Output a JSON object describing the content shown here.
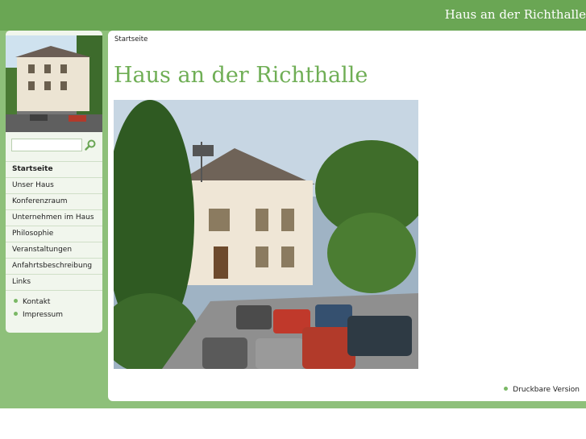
{
  "header": {
    "site_title": "Haus an der Richthalle"
  },
  "sidebar": {
    "search": {
      "value": "",
      "placeholder": ""
    },
    "nav": [
      {
        "label": "Startseite",
        "active": true
      },
      {
        "label": "Unser Haus"
      },
      {
        "label": "Konferenzraum"
      },
      {
        "label": "Unternehmen im Haus"
      },
      {
        "label": "Philosophie"
      },
      {
        "label": "Veranstaltungen"
      },
      {
        "label": "Anfahrtsbeschreibung"
      },
      {
        "label": "Links"
      }
    ],
    "secondary": [
      {
        "label": "Kontakt"
      },
      {
        "label": "Impressum"
      }
    ]
  },
  "main": {
    "breadcrumb": "Startseite",
    "heading": "Haus an der Richthalle",
    "print_link": "Druckbare Version"
  },
  "colors": {
    "brand_dark": "#6aa654",
    "brand_light": "#8ec07a",
    "heading": "#6fae55"
  },
  "icons": {
    "search": "magnifier-icon",
    "bullet": "green-dot"
  }
}
